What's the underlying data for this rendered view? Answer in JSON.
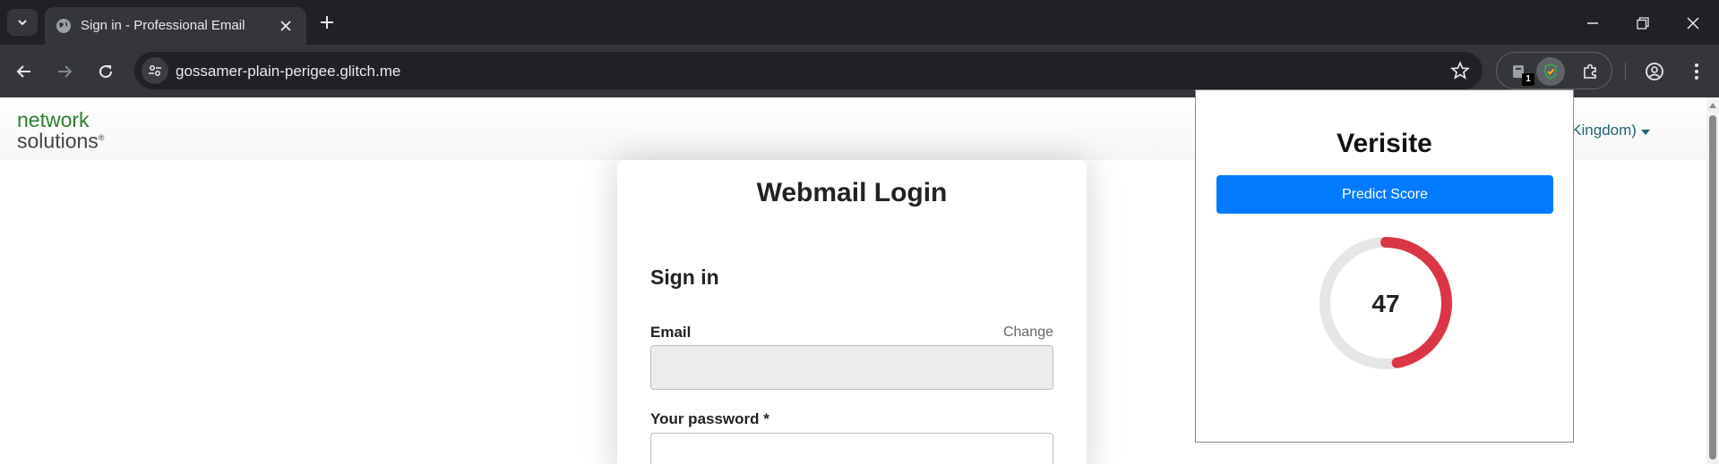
{
  "browser": {
    "tab_title": "Sign in - Professional Email",
    "url": "gossamer-plain-perigee.glitch.me",
    "extension_badge": "1"
  },
  "site": {
    "logo_line1": "network",
    "logo_line2": "solutions",
    "logo_mark": "®",
    "language": "d Kingdom)",
    "card_title": "Webmail Login",
    "sign_in_heading": "Sign in",
    "email_label": "Email",
    "change_link": "Change",
    "password_label": "Your password *"
  },
  "popup": {
    "title": "Verisite",
    "predict_button": "Predict Score",
    "score": "47",
    "score_value": 47,
    "score_max": 100,
    "score_color": "#dc3545",
    "track_color": "#e6e6e6",
    "button_color": "#007bff"
  }
}
